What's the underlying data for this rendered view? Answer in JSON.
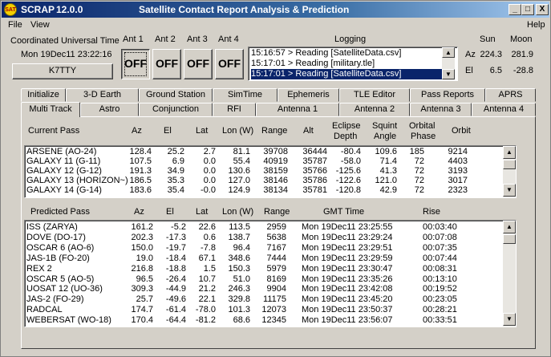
{
  "window": {
    "app_icon": "SAT",
    "app_name": "SCRAP",
    "version": "12.0.0",
    "caption": "Satellite Contact Report Analysis & Prediction",
    "controls": [
      "_",
      "□",
      "X"
    ]
  },
  "menu": {
    "file": "File",
    "view": "View",
    "help": "Help"
  },
  "utc": {
    "label": "Coordinated Universal Time",
    "value": "Mon 19Dec11 23:22:16",
    "callsign": "K7TTY"
  },
  "antennas": [
    {
      "label": "Ant 1",
      "state": "OFF"
    },
    {
      "label": "Ant 2",
      "state": "OFF"
    },
    {
      "label": "Ant 3",
      "state": "OFF"
    },
    {
      "label": "Ant 4",
      "state": "OFF"
    }
  ],
  "logging": {
    "label": "Logging",
    "lines": [
      "15:16:57 > Reading [SatelliteData.csv]",
      "15:17:01 > Reading [military.tle]",
      "15:17:01 > Reading [SatelliteData.csv]"
    ]
  },
  "sunmoon": {
    "sun_label": "Sun",
    "moon_label": "Moon",
    "az_label": "Az",
    "el_label": "El",
    "sun_az": "224.3",
    "moon_az": "281.9",
    "sun_el": "6.5",
    "moon_el": "-28.8"
  },
  "tabs": {
    "row_back": [
      "Initialize",
      "3-D Earth",
      "Ground Station",
      "SimTime",
      "Ephemeris",
      "TLE Editor",
      "Pass Reports",
      "APRS"
    ],
    "row_front": [
      "Multi Track",
      "Astro",
      "Conjunction",
      "RFI",
      "Antenna 1",
      "Antenna 2",
      "Antenna 3",
      "Antenna 4"
    ],
    "active": "Multi Track"
  },
  "current": {
    "title": "Current Pass",
    "headers": {
      "az": "Az",
      "el": "El",
      "lat": "Lat",
      "lon": "Lon (W)",
      "range": "Range",
      "alt": "Alt",
      "eclipse_1": "Eclipse",
      "eclipse_2": "Depth",
      "squint_1": "Squint",
      "squint_2": "Angle",
      "orbital_1": "Orbital",
      "orbital_2": "Phase",
      "orbit": "Orbit"
    },
    "rows": [
      {
        "name": "ARSENE (AO-24)",
        "az": "128.4",
        "el": "25.2",
        "lat": "2.7",
        "lon": "81.1",
        "range": "39708",
        "alt": "36444",
        "eclipse": "-80.4",
        "squint": "109.6",
        "phase": "185",
        "orbit": "9214"
      },
      {
        "name": "GALAXY 11 (G-11)",
        "az": "107.5",
        "el": "6.9",
        "lat": "0.0",
        "lon": "55.4",
        "range": "40919",
        "alt": "35787",
        "eclipse": "-58.0",
        "squint": "71.4",
        "phase": "72",
        "orbit": "4403"
      },
      {
        "name": "GALAXY 12 (G-12)",
        "az": "191.3",
        "el": "34.9",
        "lat": "0.0",
        "lon": "130.6",
        "range": "38159",
        "alt": "35766",
        "eclipse": "-125.6",
        "squint": "41.3",
        "phase": "72",
        "orbit": "3193"
      },
      {
        "name": "GALAXY 13 (HORIZON~)",
        "az": "186.5",
        "el": "35.3",
        "lat": "0.0",
        "lon": "127.0",
        "range": "38146",
        "alt": "35786",
        "eclipse": "-122.6",
        "squint": "121.0",
        "phase": "72",
        "orbit": "3017"
      },
      {
        "name": "GALAXY 14 (G-14)",
        "az": "183.6",
        "el": "35.4",
        "lat": "-0.0",
        "lon": "124.9",
        "range": "38134",
        "alt": "35781",
        "eclipse": "-120.8",
        "squint": "42.9",
        "phase": "72",
        "orbit": "2323"
      }
    ]
  },
  "predicted": {
    "title": "Predicted Pass",
    "headers": {
      "az": "Az",
      "el": "El",
      "lat": "Lat",
      "lon": "Lon (W)",
      "range": "Range",
      "gmt": "GMT Time",
      "rise": "Rise"
    },
    "rows": [
      {
        "name": "ISS (ZARYA)",
        "az": "161.2",
        "el": "-5.2",
        "lat": "22.6",
        "lon": "113.5",
        "range": "2959",
        "gmt": "Mon 19Dec11 23:25:55",
        "rise": "00:03:40"
      },
      {
        "name": "DOVE (DO-17)",
        "az": "202.3",
        "el": "-17.3",
        "lat": "0.6",
        "lon": "138.7",
        "range": "5638",
        "gmt": "Mon 19Dec11 23:29:24",
        "rise": "00:07:08"
      },
      {
        "name": "OSCAR 6 (AO-6)",
        "az": "150.0",
        "el": "-19.7",
        "lat": "-7.8",
        "lon": "96.4",
        "range": "7167",
        "gmt": "Mon 19Dec11 23:29:51",
        "rise": "00:07:35"
      },
      {
        "name": "JAS-1B (FO-20)",
        "az": "19.0",
        "el": "-18.4",
        "lat": "67.1",
        "lon": "348.6",
        "range": "7444",
        "gmt": "Mon 19Dec11 23:29:59",
        "rise": "00:07:44"
      },
      {
        "name": "REX 2",
        "az": "216.8",
        "el": "-18.8",
        "lat": "1.5",
        "lon": "150.3",
        "range": "5979",
        "gmt": "Mon 19Dec11 23:30:47",
        "rise": "00:08:31"
      },
      {
        "name": "OSCAR 5 (AO-5)",
        "az": "96.5",
        "el": "-26.4",
        "lat": "10.7",
        "lon": "51.0",
        "range": "8169",
        "gmt": "Mon 19Dec11 23:35:26",
        "rise": "00:13:10"
      },
      {
        "name": "UOSAT 12 (UO-36)",
        "az": "309.3",
        "el": "-44.9",
        "lat": "21.2",
        "lon": "246.3",
        "range": "9904",
        "gmt": "Mon 19Dec11 23:42:08",
        "rise": "00:19:52"
      },
      {
        "name": "JAS-2 (FO-29)",
        "az": "25.7",
        "el": "-49.6",
        "lat": "22.1",
        "lon": "329.8",
        "range": "11175",
        "gmt": "Mon 19Dec11 23:45:20",
        "rise": "00:23:05"
      },
      {
        "name": "RADCAL",
        "az": "174.7",
        "el": "-61.4",
        "lat": "-78.0",
        "lon": "101.3",
        "range": "12073",
        "gmt": "Mon 19Dec11 23:50:37",
        "rise": "00:28:21"
      },
      {
        "name": "WEBERSAT (WO-18)",
        "az": "170.4",
        "el": "-64.4",
        "lat": "-81.2",
        "lon": "68.6",
        "range": "12345",
        "gmt": "Mon 19Dec11 23:56:07",
        "rise": "00:33:51"
      }
    ]
  },
  "scroll": {
    "up": "▲",
    "down": "▼"
  },
  "colors": {
    "titlebar_start": "#0a246a",
    "titlebar_end": "#a6caf0",
    "face": "#d4d0c8",
    "selection": "#0a246a"
  }
}
